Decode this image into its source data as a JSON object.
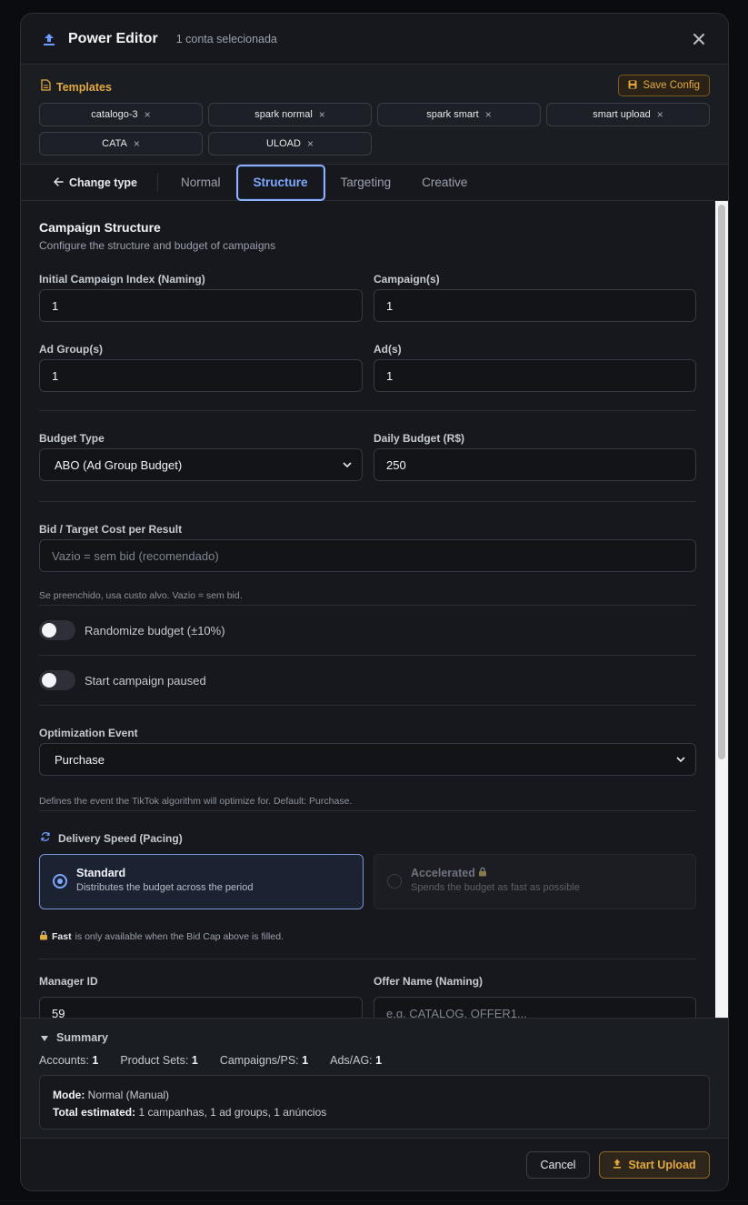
{
  "header": {
    "title": "Power Editor",
    "subtitle": "1 conta selecionada",
    "close_icon": "close-icon"
  },
  "templates": {
    "label": "Templates",
    "save_label": "Save Config",
    "items": [
      {
        "name": "catalogo-3"
      },
      {
        "name": "spark normal"
      },
      {
        "name": "spark smart"
      },
      {
        "name": "smart upload"
      },
      {
        "name": "CATA"
      },
      {
        "name": "ULOAD"
      }
    ],
    "remove_glyph": "×"
  },
  "tabs": {
    "back_label": "Change type",
    "items": [
      {
        "label": "Normal",
        "active": false
      },
      {
        "label": "Structure",
        "active": true
      },
      {
        "label": "Targeting",
        "active": false
      },
      {
        "label": "Creative",
        "active": false
      }
    ]
  },
  "structure": {
    "title": "Campaign Structure",
    "subtitle": "Configure the structure and budget of campaigns",
    "initial_index": {
      "label": "Initial Campaign Index (Naming)",
      "value": "1"
    },
    "campaigns": {
      "label": "Campaign(s)",
      "value": "1"
    },
    "ad_groups": {
      "label": "Ad Group(s)",
      "value": "1"
    },
    "ads": {
      "label": "Ad(s)",
      "value": "1"
    },
    "budget_type": {
      "label": "Budget Type",
      "value": "ABO (Ad Group Budget)"
    },
    "daily_budget": {
      "label": "Daily Budget (R$)",
      "value": "250"
    },
    "bid": {
      "label": "Bid / Target Cost per Result",
      "placeholder": "Vazio = sem bid (recomendado)",
      "helper": "Se preenchido, usa custo alvo. Vazio = sem bid."
    },
    "randomize": {
      "label": "Randomize budget (±10%)",
      "on": false
    },
    "start_paused": {
      "label": "Start campaign paused",
      "on": false
    },
    "optimization": {
      "label": "Optimization Event",
      "value": "Purchase",
      "helper": "Defines the event the TikTok algorithm will optimize for. Default: Purchase."
    },
    "pacing": {
      "label": "Delivery Speed (Pacing)",
      "options": [
        {
          "title": "Standard",
          "desc": "Distributes the budget across the period",
          "selected": true
        },
        {
          "title": "Accelerated",
          "desc": "Spends the budget as fast as possible",
          "selected": false
        }
      ],
      "note_bold": "Fast",
      "note_rest": "is only available when the Bid Cap above is filled."
    },
    "manager_id": {
      "label": "Manager ID",
      "value": "59"
    },
    "offer_name": {
      "label": "Offer Name (Naming)",
      "placeholder": "e.g. CATALOG, OFFER1..."
    }
  },
  "summary": {
    "title": "Summary",
    "stats": [
      {
        "label": "Accounts:",
        "value": "1"
      },
      {
        "label": "Product Sets:",
        "value": "1"
      },
      {
        "label": "Campaigns/PS:",
        "value": "1"
      },
      {
        "label": "Ads/AG:",
        "value": "1"
      }
    ],
    "mode_label": "Mode:",
    "mode_value": "Normal (Manual)",
    "total_label": "Total estimated:",
    "total_value": "1 campanhas, 1 ad groups, 1 anúncios"
  },
  "footer": {
    "cancel_label": "Cancel",
    "start_label": "Start Upload"
  },
  "colors": {
    "accent_blue": "#7ea8ff",
    "accent_gold": "#e2a93b",
    "background": "#16181d"
  }
}
